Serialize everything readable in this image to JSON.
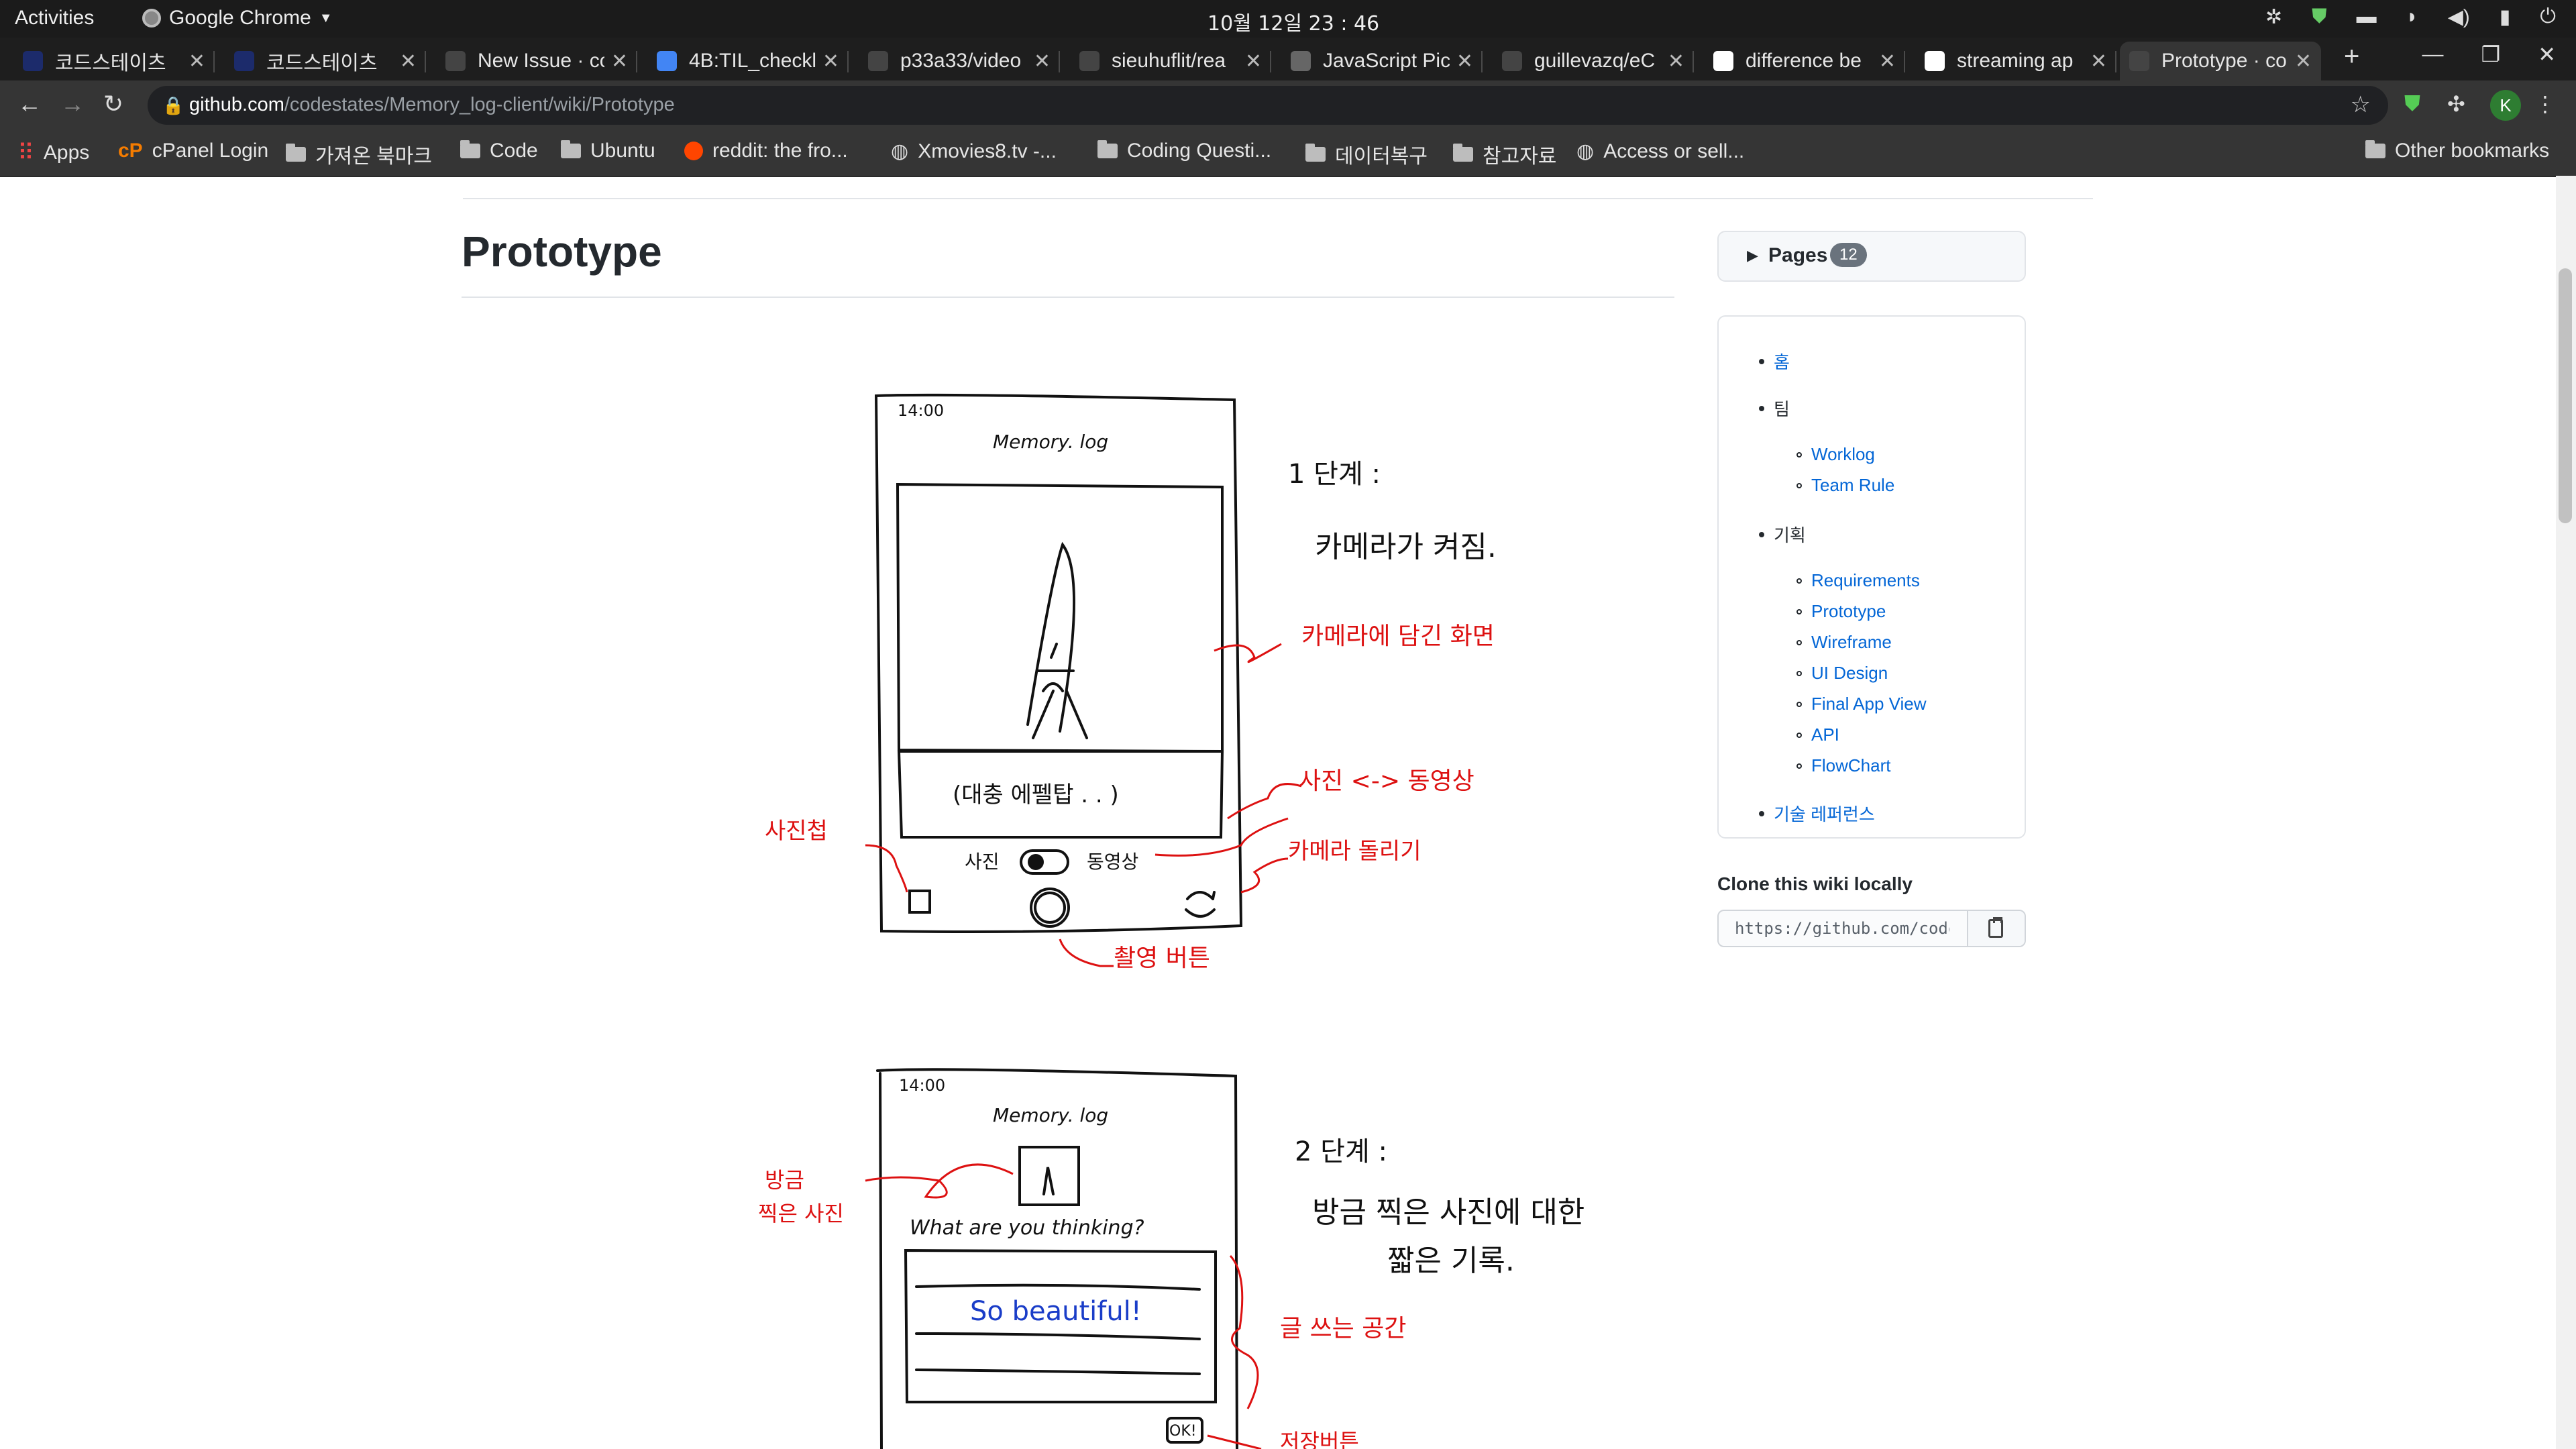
{
  "os": {
    "activities": "Activities",
    "app_name": "Google Chrome",
    "clock": "10월 12일  23 : 46"
  },
  "tabs": [
    {
      "title": "코드스테이츠",
      "active": false
    },
    {
      "title": "코드스테이츠",
      "active": false
    },
    {
      "title": "New Issue · co",
      "active": false
    },
    {
      "title": "4B:TIL_checkl",
      "active": false
    },
    {
      "title": "p33a33/video",
      "active": false
    },
    {
      "title": "sieuhuflit/rea",
      "active": false
    },
    {
      "title": "JavaScript Pic",
      "active": false
    },
    {
      "title": "guillevazq/eC",
      "active": false
    },
    {
      "title": "difference be",
      "active": false
    },
    {
      "title": "streaming ap",
      "active": false
    },
    {
      "title": "Prototype · co",
      "active": true
    }
  ],
  "toolbar": {
    "url_host": "github.com",
    "url_path": "/codestates/Memory_log-client/wiki/Prototype",
    "profile_initial": "K"
  },
  "bookmarks": [
    {
      "label": "Apps",
      "icon": "apps-grid-icon"
    },
    {
      "label": "cPanel Login",
      "icon": "cpanel-icon"
    },
    {
      "label": "가져온 북마크",
      "icon": "folder-icon"
    },
    {
      "label": "Code",
      "icon": "folder-icon"
    },
    {
      "label": "Ubuntu",
      "icon": "folder-icon"
    },
    {
      "label": "reddit: the fro...",
      "icon": "reddit-icon"
    },
    {
      "label": "Xmovies8.tv -...",
      "icon": "globe-icon"
    },
    {
      "label": "Coding Questi...",
      "icon": "folder-icon"
    },
    {
      "label": "데이터복구",
      "icon": "folder-icon"
    },
    {
      "label": "참고자료",
      "icon": "folder-icon"
    },
    {
      "label": "Access or sell...",
      "icon": "globe-icon"
    },
    {
      "label": "Other bookmarks",
      "icon": "folder-icon"
    }
  ],
  "page": {
    "title": "Prototype"
  },
  "sidebar": {
    "pages_label": "Pages",
    "pages_count": "12",
    "nav": {
      "home": "홈",
      "team": "팀",
      "worklog": "Worklog",
      "team_rule": "Team Rule",
      "planning": "기획",
      "requirements": "Requirements",
      "prototype": "Prototype",
      "wireframe": "Wireframe",
      "ui_design": "UI Design",
      "final_app_view": "Final App View",
      "api": "API",
      "flowchart": "FlowChart",
      "tech_reference": "기술 레퍼런스"
    },
    "clone_label": "Clone this wiki locally",
    "clone_url": "https://github.com/codestates/Memory_log-client.wiki.git"
  },
  "sketch1": {
    "time": "14:00",
    "app_title": "Memory. log",
    "caption": "(대충 에펠탑 . . )",
    "toggle_left": "사진",
    "toggle_right": "동영상",
    "step_title": "1 단계 :",
    "step_desc": "카메라가 켜짐.",
    "ann_screen": "카메라에 담긴 화면",
    "ann_toggle": "사진 <-> 동영상",
    "ann_rotate": "카메라 돌리기",
    "ann_album": "사진첩",
    "ann_shutter": "촬영 버튼"
  },
  "sketch2": {
    "time": "14:00",
    "app_title": "Memory. log",
    "question": "What are you thinking?",
    "text": "So beautiful!",
    "ok": "OK!",
    "step_title": "2 단계 :",
    "step_desc1": "방금 찍은 사진에 대한",
    "step_desc2": "짧은 기록.",
    "ann_photo1": "방금",
    "ann_photo2": "찍은 사진",
    "ann_write": "글 쓰는 공간",
    "ann_ok": "저장버튼"
  }
}
